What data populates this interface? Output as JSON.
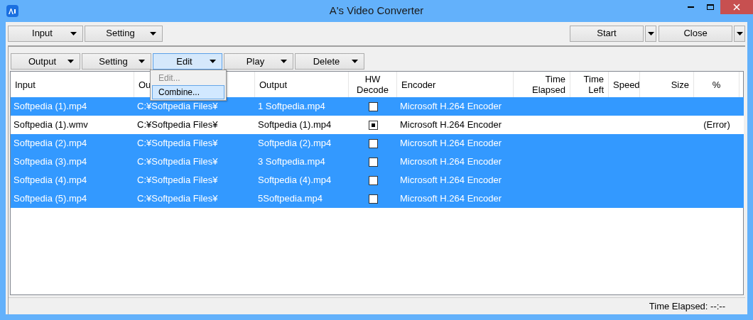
{
  "window": {
    "title": "A's Video Converter"
  },
  "main_toolbar": {
    "left": [
      {
        "label": "Input"
      },
      {
        "label": "Setting"
      }
    ],
    "right": [
      {
        "label": "Start"
      },
      {
        "label": "Close"
      }
    ]
  },
  "list_toolbar": [
    {
      "label": "Output",
      "active": false
    },
    {
      "label": "Setting",
      "active": false
    },
    {
      "label": "Edit",
      "active": true
    },
    {
      "label": "Play",
      "active": false
    },
    {
      "label": "Delete",
      "active": false
    }
  ],
  "edit_menu": [
    {
      "label": "Edit...",
      "disabled": true,
      "selected": false
    },
    {
      "label": "Combine...",
      "disabled": false,
      "selected": true
    }
  ],
  "table": {
    "columns": [
      {
        "label": "Input"
      },
      {
        "label": "Ou"
      },
      {
        "label": "Output"
      },
      {
        "label": "HW Decode"
      },
      {
        "label": "Encoder"
      },
      {
        "label": "Time Elapsed"
      },
      {
        "label": "Time Left"
      },
      {
        "label": "Speed"
      },
      {
        "label": "Size"
      },
      {
        "label": "%"
      }
    ],
    "rows": [
      {
        "selected": true,
        "input": "Softpedia (1).mp4",
        "folder": "C:¥Softpedia Files¥",
        "output": "1 Softpedia.mp4",
        "hw_decode": false,
        "encoder": "Microsoft H.264 Encoder"
      },
      {
        "selected": false,
        "input": "Softpedia (1).wmv",
        "folder": "C:¥Softpedia Files¥",
        "output": "Softpedia (1).mp4",
        "hw_decode": true,
        "encoder": "Microsoft H.264 Encoder",
        "percent": "(Error)"
      },
      {
        "selected": true,
        "input": "Softpedia (2).mp4",
        "folder": "C:¥Softpedia Files¥",
        "output": "Softpedia (2).mp4",
        "hw_decode": false,
        "encoder": "Microsoft H.264 Encoder"
      },
      {
        "selected": true,
        "input": "Softpedia (3).mp4",
        "folder": "C:¥Softpedia Files¥",
        "output": "3 Softpedia.mp4",
        "hw_decode": false,
        "encoder": "Microsoft H.264 Encoder"
      },
      {
        "selected": true,
        "input": "Softpedia (4).mp4",
        "folder": "C:¥Softpedia Files¥",
        "output": "Softpedia (4).mp4",
        "hw_decode": false,
        "encoder": "Microsoft H.264 Encoder"
      },
      {
        "selected": true,
        "input": "Softpedia (5).mp4",
        "folder": "C:¥Softpedia Files¥",
        "output": "5Softpedia.mp4",
        "hw_decode": false,
        "encoder": "Microsoft H.264 Encoder"
      }
    ]
  },
  "status_bar": {
    "time_elapsed": "Time Elapsed: --:--"
  }
}
